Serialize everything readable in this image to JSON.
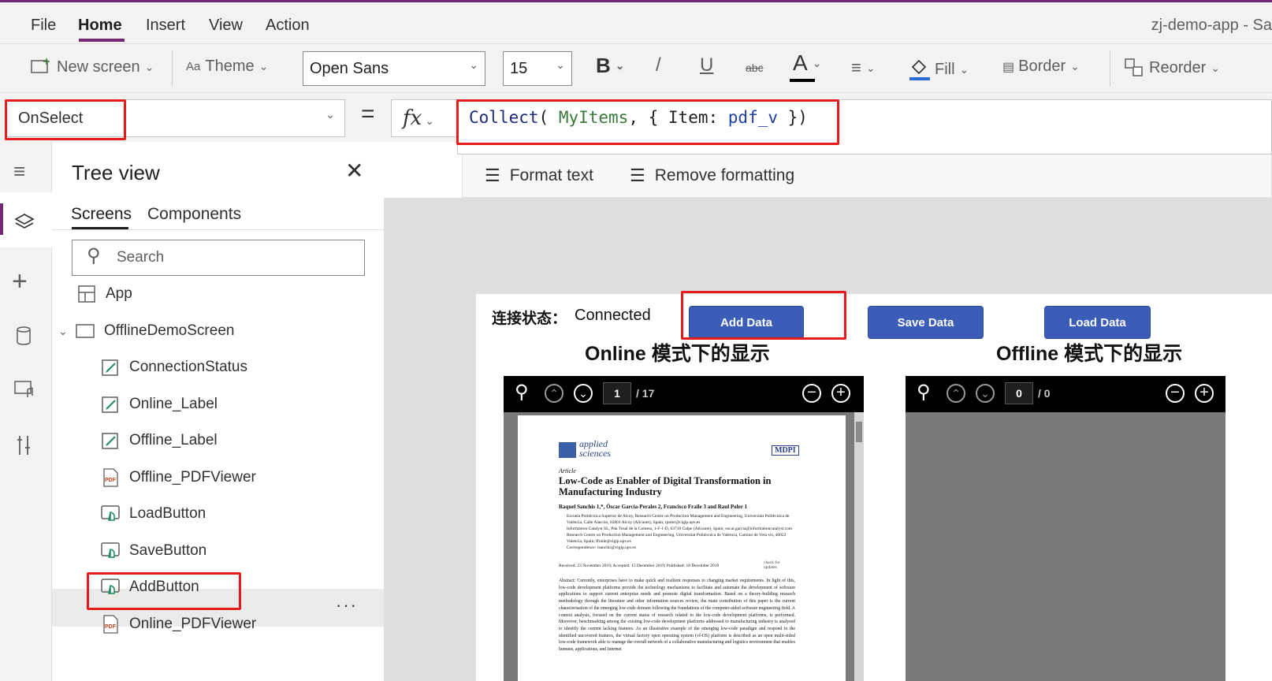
{
  "menu": {
    "items": [
      "File",
      "Home",
      "Insert",
      "View",
      "Action"
    ],
    "app_title": "zj-demo-app - Sa"
  },
  "ribbon": {
    "new_screen": "New screen",
    "theme": "Theme",
    "font": "Open Sans",
    "font_size": "15",
    "bold": "B",
    "italic": "/",
    "underline": "U",
    "strike": "abc",
    "font_color": "A",
    "fill": "Fill",
    "border": "Border",
    "reorder": "Reorder"
  },
  "formula_bar": {
    "property": "OnSelect",
    "equals": "=",
    "fx": "fx",
    "formula_tokens": [
      "Collect",
      "( ",
      "MyItems",
      ", { ",
      "Item",
      ": ",
      "pdf_v",
      " })"
    ]
  },
  "format_bar": {
    "format_text": "Format text",
    "remove_formatting": "Remove formatting"
  },
  "tree_view": {
    "title": "Tree view",
    "tabs": [
      "Screens",
      "Components"
    ],
    "search_placeholder": "Search",
    "app": "App",
    "screen": "OfflineDemoScreen",
    "controls": [
      {
        "name": "ConnectionStatus",
        "icon": "label-icon"
      },
      {
        "name": "Online_Label",
        "icon": "label-icon"
      },
      {
        "name": "Offline_Label",
        "icon": "label-icon"
      },
      {
        "name": "Offline_PDFViewer",
        "icon": "pdf-icon"
      },
      {
        "name": "LoadButton",
        "icon": "button-icon"
      },
      {
        "name": "SaveButton",
        "icon": "button-icon"
      },
      {
        "name": "AddButton",
        "icon": "button-icon"
      },
      {
        "name": "Online_PDFViewer",
        "icon": "pdf-icon"
      }
    ],
    "selected": "AddButton",
    "more": "···"
  },
  "app_screen": {
    "conn_label": "连接状态：",
    "conn_value": "Connected",
    "add_button": "Add Data",
    "save_button": "Save Data",
    "load_button": "Load Data",
    "online_title": "Online 模式下的显示",
    "offline_title": "Offline 模式下的显示",
    "online_pdf": {
      "page": "1",
      "total": "/ 17"
    },
    "offline_pdf": {
      "page": "0",
      "total": "/ 0"
    },
    "paper": {
      "journal": "applied sciences",
      "publisher": "MDPI",
      "type": "Article",
      "title": "Low-Code as Enabler of Digital Transformation in Manufacturing Industry",
      "authors": "Raquel Sanchis 1,*, Óscar García-Perales 2, Francisco Fraile 3 and Raul Poler 1",
      "affiliations": [
        "Escuela Politécnica Superior de Alcoy, Research Centre on Production Management and Engineering, Universitat Politècnica de València, Calle Alarcón, 03801 Alcoy (Alicante), Spain; rpoler@cigip.upv.es",
        "Information Catalyst SL, Pda Tosal de la Cometa, 1-F-1-D, 03710 Calpe (Alicante), Spain; oscar.garcia@informationcatalyst.com",
        "Research Centre on Production Management and Engineering, Universitat Politècnica de València, Camino de Vera s/n, 46022 Valencia, Spain; ffraile@cigip.upv.es",
        "Correspondence: rsanchis@cigip.upv.es"
      ],
      "received": "Received: 23 November 2019; Accepted: 15 December 2019; Published: 18 December 2019",
      "updates": "check for updates",
      "abstract": "Abstract: Currently, enterprises have to make quick and resilient responses to changing market requirements. In light of this, low-code development platforms provide the technology mechanisms to facilitate and automate the development of software applications to support current enterprise needs and promote digital transformation. Based on a theory-building research methodology through the literature and other information sources review, the main contribution of this paper is the current characterisation of the emerging low-code domain following the foundations of the computer-aided software engineering field. A context analysis, focused on the current status of research related to the low-code development platforms, is performed. Moreover, benchmarking among the existing low-code development platforms addressed to manufacturing industry is analysed to identify the current lacking features. As an illustrative example of the emerging low-code paradigm and respond to the identified uncovered features, the virtual factory open operating system (vf-OS) platform is described as an open multi-sided low-code framework able to manage the overall network of a collaborative manufacturing and logistics environment that enables humans, applications, and Internet"
    }
  },
  "colors": {
    "accent": "#742774",
    "highlight": "#e51b1b",
    "button": "#3b5db7"
  }
}
